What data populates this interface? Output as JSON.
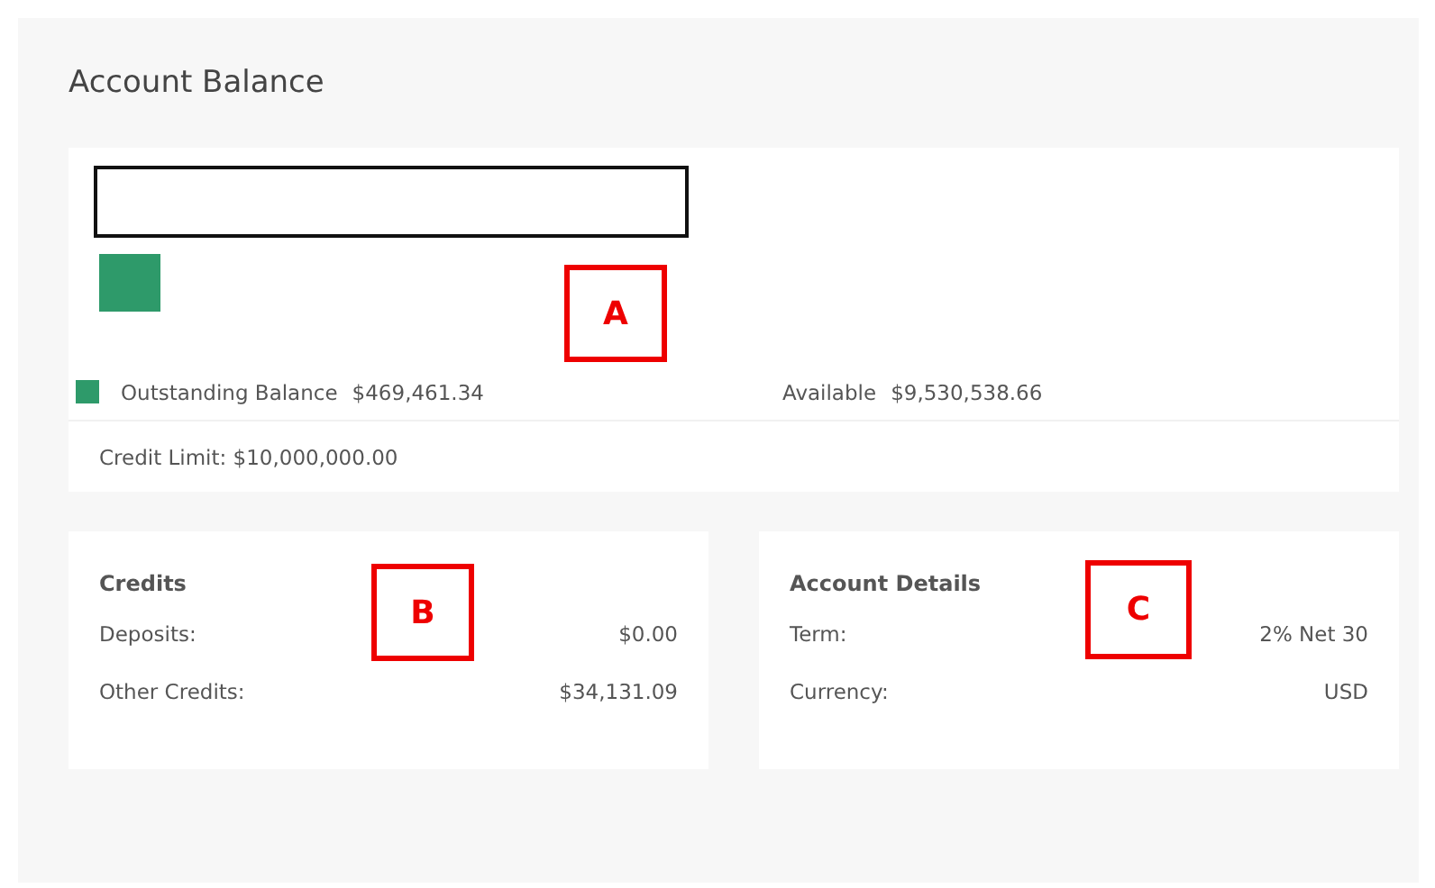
{
  "title": "Account Balance",
  "balance": {
    "legend": [
      {
        "label": "Outstanding Balance",
        "amount": "$469,461.34",
        "color": "#2e9a6a"
      },
      {
        "label": "Available",
        "amount": "$9,530,538.66"
      }
    ],
    "credit_limit": "Credit Limit: $10,000,000.00"
  },
  "cards": [
    {
      "title": "Credits",
      "rows": [
        {
          "label": "Deposits:",
          "value": "$0.00"
        },
        {
          "label": "Other Credits:",
          "value": "$34,131.09"
        }
      ]
    },
    {
      "title": "Account Details",
      "rows": [
        {
          "label": "Term:",
          "value": "2% Net 30"
        },
        {
          "label": "Currency:",
          "value": "USD"
        }
      ]
    }
  ],
  "callouts": [
    "A",
    "B",
    "C"
  ]
}
